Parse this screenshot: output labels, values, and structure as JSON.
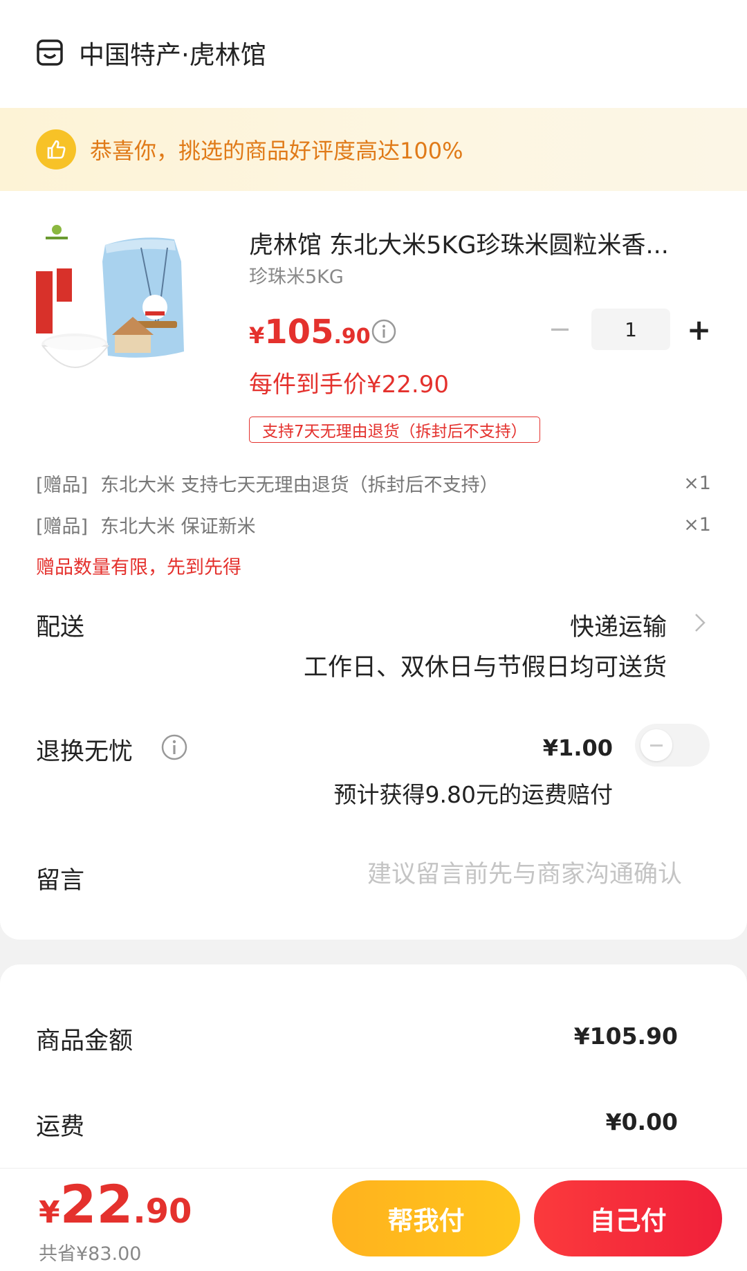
{
  "shop": {
    "name": "中国特产·虎林馆",
    "icon": "shop-icon"
  },
  "banner": {
    "text": "恭喜你，挑选的商品好评度高达100%",
    "icon": "thumbs-up-icon"
  },
  "product": {
    "title": "虎林馆 东北大米5KG珍珠米圆粒米香...",
    "spec": "珍珠米5KG",
    "price_currency": "¥",
    "price_int": "105",
    "price_dec": ".90",
    "unit_price_text": "每件到手价¥22.90",
    "return_tag": "支持7天无理由退货（拆封后不支持）",
    "quantity": "1",
    "image_icon": "rice-bag-image"
  },
  "gifts": [
    {
      "tag": "[赠品]",
      "name": "东北大米 支持七天无理由退货（拆封后不支持）",
      "count": "×1"
    },
    {
      "tag": "[赠品]",
      "name": "东北大米 保证新米",
      "count": "×1"
    }
  ],
  "gift_note": "赠品数量有限，先到先得",
  "delivery": {
    "label": "配送",
    "value": "快递运输",
    "sub": "工作日、双休日与节假日均可送货"
  },
  "worry_free": {
    "label": "退换无忧",
    "price": "¥1.00",
    "sub": "预计获得9.80元的运费赔付",
    "enabled": false
  },
  "message": {
    "label": "留言",
    "placeholder": "建议留言前先与商家沟通确认"
  },
  "summary": {
    "goods_label": "商品金额",
    "goods_value": "¥105.90",
    "shipping_label": "运费",
    "shipping_value": "¥0.00"
  },
  "footer": {
    "total_currency": "¥",
    "total_int": "22",
    "total_dec": ".90",
    "saved": "共省¥83.00",
    "help_pay": "帮我付",
    "self_pay": "自己付"
  },
  "colors": {
    "accent": "#e4312d",
    "banner_text": "#e07a18",
    "help_btn": "#ffb21e",
    "self_btn": "#f0203a"
  }
}
